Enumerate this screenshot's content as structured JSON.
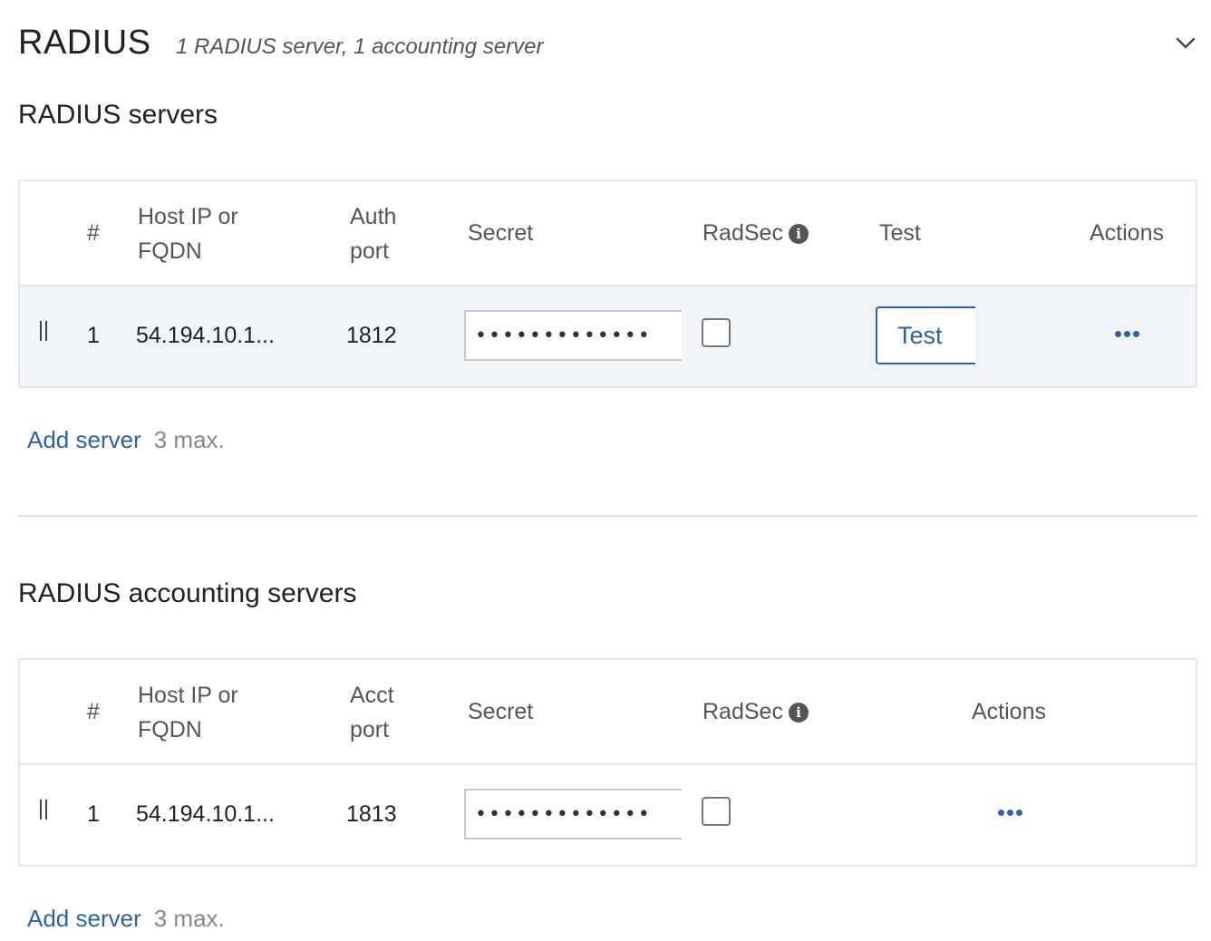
{
  "header": {
    "title": "RADIUS",
    "summary": "1 RADIUS server, 1 accounting server",
    "collapse_icon": "chevron-down-icon"
  },
  "auth": {
    "section_title": "RADIUS servers",
    "columns": {
      "num": "#",
      "host": [
        "Host IP or",
        "FQDN"
      ],
      "port": [
        "Auth",
        "port"
      ],
      "secret": "Secret",
      "radsec": "RadSec",
      "test": "Test",
      "actions": "Actions"
    },
    "rows": [
      {
        "num": "1",
        "host": "54.194.10.1...",
        "port": "1812",
        "secret_mask": "•••••••••••••",
        "radsec_checked": false,
        "test_label": "Test"
      }
    ],
    "add_label": "Add server",
    "max_label": "3 max."
  },
  "acct": {
    "section_title": "RADIUS accounting servers",
    "columns": {
      "num": "#",
      "host": [
        "Host IP or",
        "FQDN"
      ],
      "port": [
        "Acct",
        "port"
      ],
      "secret": "Secret",
      "radsec": "RadSec",
      "actions": "Actions"
    },
    "rows": [
      {
        "num": "1",
        "host": "54.194.10.1...",
        "port": "1813",
        "secret_mask": "•••••••••••••",
        "radsec_checked": false
      }
    ],
    "add_label": "Add server",
    "max_label": "3 max."
  },
  "colors": {
    "accent": "#2d62a8",
    "row_highlight": "#f1f5f9",
    "border": "#e6e6e6"
  },
  "icons": {
    "info": "info-icon",
    "drag": "drag-handle-icon",
    "more": "more-actions-icon"
  }
}
